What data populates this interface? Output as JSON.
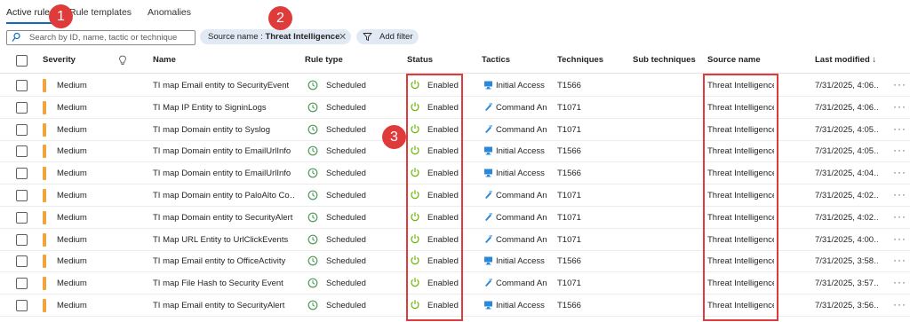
{
  "tabs": [
    {
      "label": "Active rules"
    },
    {
      "label": "Rule templates"
    },
    {
      "label": "Anomalies"
    }
  ],
  "search": {
    "placeholder": "Search by ID, name, tactic or technique"
  },
  "filters": {
    "source_filter": {
      "key": "Source name :",
      "value": "Threat Intelligence"
    },
    "add_filter_label": "Add filter"
  },
  "table": {
    "columns": {
      "severity": "Severity",
      "name": "Name",
      "rule_type": "Rule type",
      "status": "Status",
      "tactics": "Tactics",
      "techniques": "Techniques",
      "sub_techniques": "Sub techniques",
      "source_name": "Source name",
      "last_modified": "Last modified ↓"
    },
    "rows": [
      {
        "severity": "Medium",
        "name": "TI map Email entity to SecurityEvent",
        "rule_type": "Scheduled",
        "status": "Enabled",
        "tactic": "Initial Access",
        "tactic_icon": "initial-access-icon",
        "technique": "T1566",
        "source": "Threat Intelligence",
        "modified": "7/31/2025, 4:06…"
      },
      {
        "severity": "Medium",
        "name": "TI Map IP Entity to SigninLogs",
        "rule_type": "Scheduled",
        "status": "Enabled",
        "tactic": "Command An",
        "tactic_icon": "command-and-control-icon",
        "technique": "T1071",
        "source": "Threat Intelligence",
        "modified": "7/31/2025, 4:06…"
      },
      {
        "severity": "Medium",
        "name": "TI map Domain entity to Syslog",
        "rule_type": "Scheduled",
        "status": "Enabled",
        "tactic": "Command An",
        "tactic_icon": "command-and-control-icon",
        "technique": "T1071",
        "source": "Threat Intelligence",
        "modified": "7/31/2025, 4:05…"
      },
      {
        "severity": "Medium",
        "name": "TI map Domain entity to EmailUrlInfo",
        "rule_type": "Scheduled",
        "status": "Enabled",
        "tactic": "Initial Access",
        "tactic_icon": "initial-access-icon",
        "technique": "T1566",
        "source": "Threat Intelligence",
        "modified": "7/31/2025, 4:05…"
      },
      {
        "severity": "Medium",
        "name": "TI map Domain entity to EmailUrlInfo",
        "rule_type": "Scheduled",
        "status": "Enabled",
        "tactic": "Initial Access",
        "tactic_icon": "initial-access-icon",
        "technique": "T1566",
        "source": "Threat Intelligence",
        "modified": "7/31/2025, 4:04…"
      },
      {
        "severity": "Medium",
        "name": "TI map Domain entity to PaloAlto Co…",
        "rule_type": "Scheduled",
        "status": "Enabled",
        "tactic": "Command An",
        "tactic_icon": "command-and-control-icon",
        "technique": "T1071",
        "source": "Threat Intelligence",
        "modified": "7/31/2025, 4:02…"
      },
      {
        "severity": "Medium",
        "name": "TI map Domain entity to SecurityAlert",
        "rule_type": "Scheduled",
        "status": "Enabled",
        "tactic": "Command An",
        "tactic_icon": "command-and-control-icon",
        "technique": "T1071",
        "source": "Threat Intelligence",
        "modified": "7/31/2025, 4:02…"
      },
      {
        "severity": "Medium",
        "name": "TI Map URL Entity to UrlClickEvents",
        "rule_type": "Scheduled",
        "status": "Enabled",
        "tactic": "Command An",
        "tactic_icon": "command-and-control-icon",
        "technique": "T1071",
        "source": "Threat Intelligence",
        "modified": "7/31/2025, 4:00…"
      },
      {
        "severity": "Medium",
        "name": "TI map Email entity to OfficeActivity",
        "rule_type": "Scheduled",
        "status": "Enabled",
        "tactic": "Initial Access",
        "tactic_icon": "initial-access-icon",
        "technique": "T1566",
        "source": "Threat Intelligence",
        "modified": "7/31/2025, 3:58…"
      },
      {
        "severity": "Medium",
        "name": "TI map File Hash to Security Event",
        "rule_type": "Scheduled",
        "status": "Enabled",
        "tactic": "Command An",
        "tactic_icon": "command-and-control-icon",
        "technique": "T1071",
        "source": "Threat Intelligence",
        "modified": "7/31/2025, 3:57…"
      },
      {
        "severity": "Medium",
        "name": "TI map Email entity to SecurityAlert",
        "rule_type": "Scheduled",
        "status": "Enabled",
        "tactic": "Initial Access",
        "tactic_icon": "initial-access-icon",
        "technique": "T1566",
        "source": "Threat Intelligence",
        "modified": "7/31/2025, 3:56…"
      }
    ],
    "more_glyph": "···"
  },
  "annotations": [
    "1",
    "2",
    "3"
  ],
  "colors": {
    "accent": "#0f6cbd",
    "severity_medium": "#f2a33a",
    "enabled": "#6bb700",
    "annotation_red": "#e03b3b",
    "filter_pill": "#e1eaf4"
  }
}
